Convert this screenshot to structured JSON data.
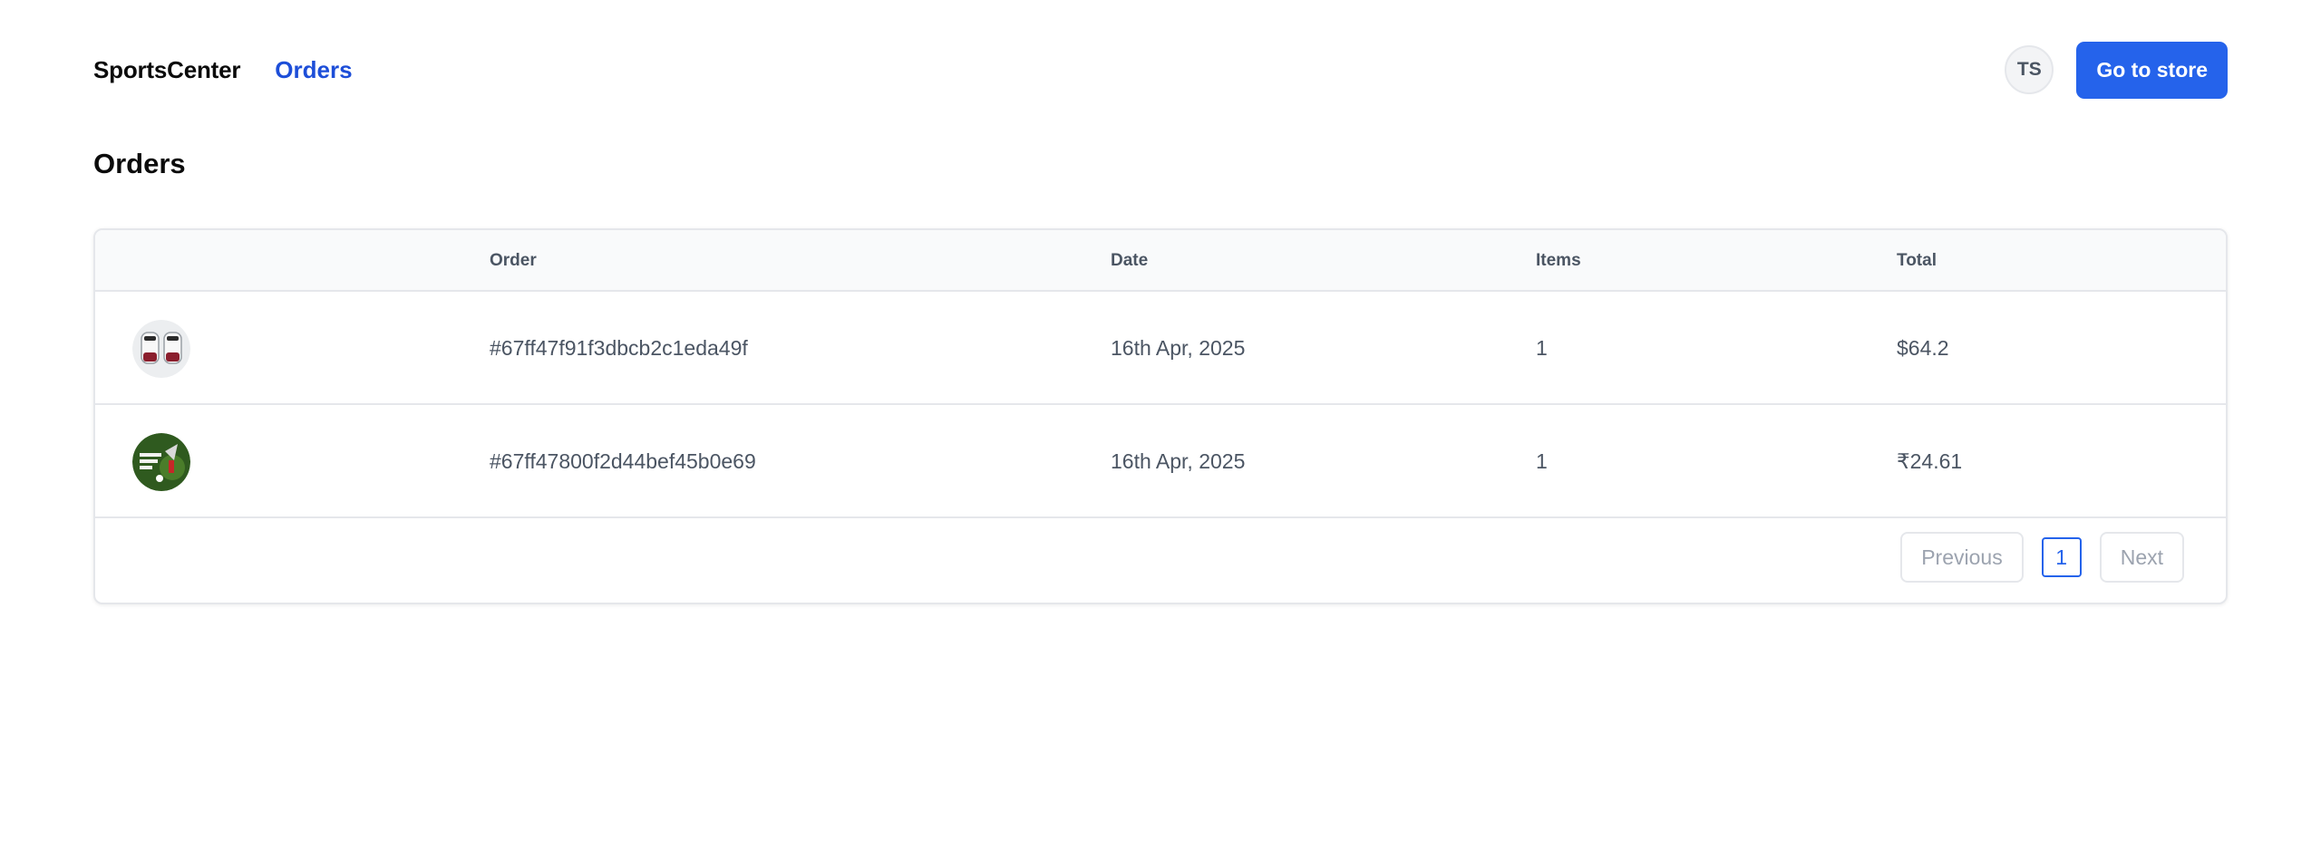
{
  "header": {
    "brand": "SportsCenter",
    "nav_orders": "Orders",
    "avatar_initials": "TS",
    "store_button": "Go to store"
  },
  "page": {
    "title": "Orders"
  },
  "table": {
    "columns": [
      "",
      "Order",
      "Date",
      "Items",
      "Total"
    ],
    "rows": [
      {
        "image": "gloves-thumbnail",
        "order": "#67ff47f91f3dbcb2c1eda49f",
        "date": "16th Apr, 2025",
        "items": "1",
        "total": "$64.2"
      },
      {
        "image": "sports-poster-thumbnail",
        "order": "#67ff47800f2d44bef45b0e69",
        "date": "16th Apr, 2025",
        "items": "1",
        "total": "₹24.61"
      }
    ]
  },
  "pagination": {
    "previous": "Previous",
    "current": "1",
    "next": "Next"
  },
  "colors": {
    "primary": "#2563eb",
    "nav_active": "#1d4ed8",
    "muted_text": "#4b5563"
  }
}
